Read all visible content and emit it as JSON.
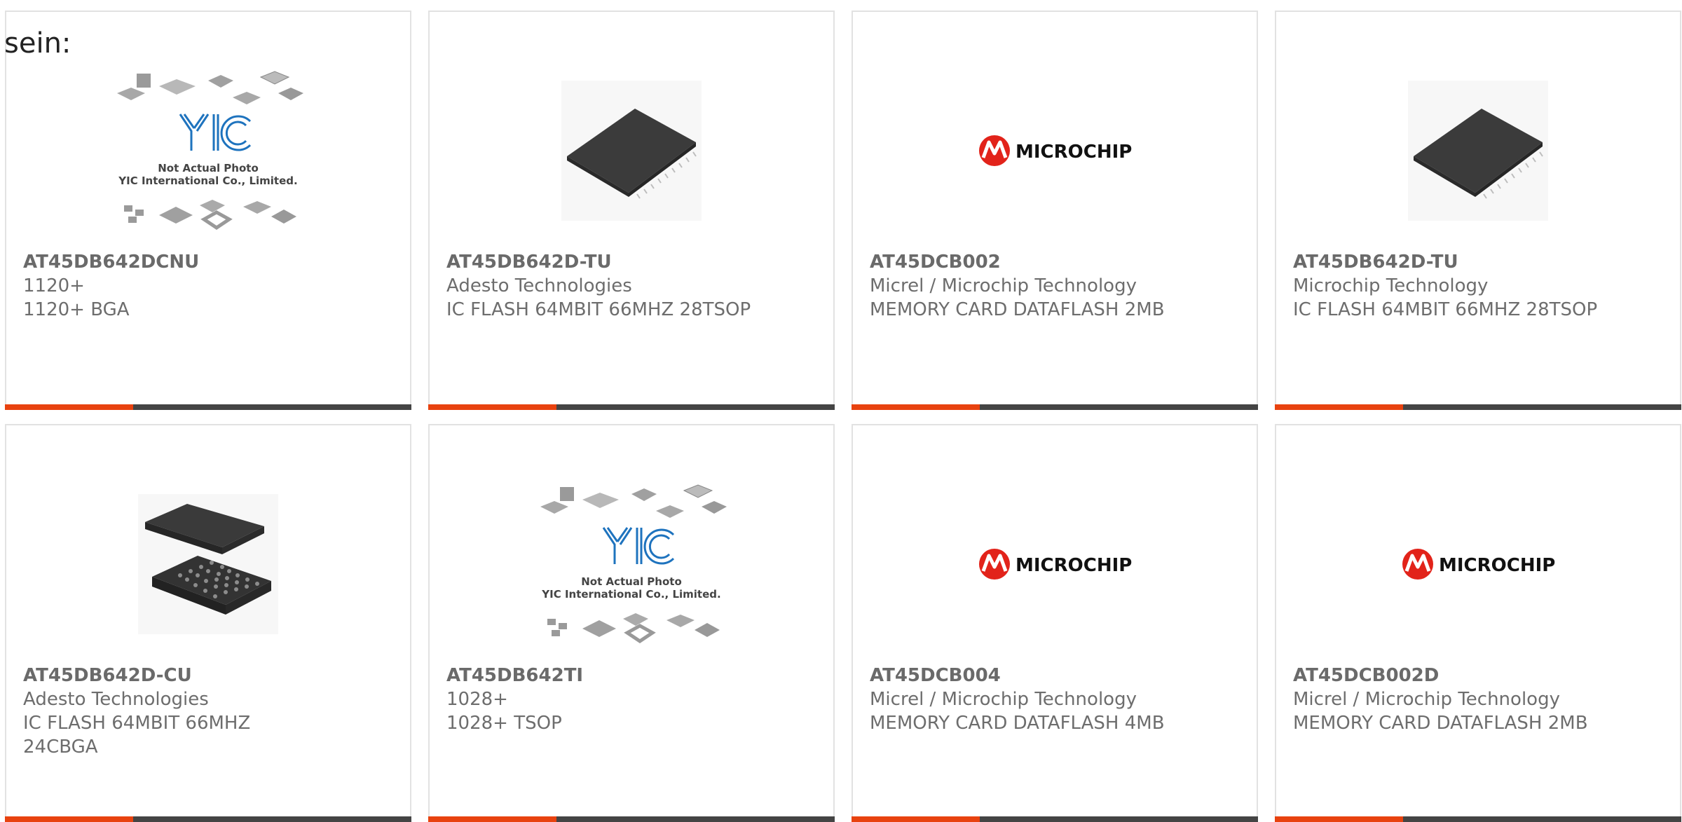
{
  "intro_text": "sein:",
  "colors": {
    "accent": "#e8420f",
    "bar": "#444444",
    "microchip_red": "#e2231a"
  },
  "cards": [
    {
      "part": "AT45DB642DCNU",
      "line1": "1120+",
      "line2": "1120+ BGA",
      "image": "yic-placeholder",
      "yic_caption1": "Not Actual Photo",
      "yic_caption2": "YIC International Co., Limited."
    },
    {
      "part": "AT45DB642D-TU",
      "line1": "Adesto Technologies",
      "line2": "IC FLASH 64MBIT 66MHZ 28TSOP",
      "image": "tsop-chip"
    },
    {
      "part": "AT45DCB002",
      "line1": "Micrel / Microchip Technology",
      "line2": "MEMORY CARD DATAFLASH 2MB",
      "image": "microchip-logo",
      "logo_text": "MICROCHIP"
    },
    {
      "part": "AT45DB642D-TU",
      "line1": "Microchip Technology",
      "line2": "IC FLASH 64MBIT 66MHZ 28TSOP",
      "image": "tsop-chip"
    },
    {
      "part": "AT45DB642D-CU",
      "line1": "Adesto Technologies",
      "line2": "IC FLASH 64MBIT 66MHZ",
      "line3": "24CBGA",
      "image": "bga-chip"
    },
    {
      "part": "AT45DB642TI",
      "line1": "1028+",
      "line2": "1028+ TSOP",
      "image": "yic-placeholder",
      "yic_caption1": "Not Actual Photo",
      "yic_caption2": "YIC International Co., Limited."
    },
    {
      "part": "AT45DCB004",
      "line1": "Micrel / Microchip Technology",
      "line2": "MEMORY CARD DATAFLASH 4MB",
      "image": "microchip-logo",
      "logo_text": "MICROCHIP"
    },
    {
      "part": "AT45DCB002D",
      "line1": "Micrel / Microchip Technology",
      "line2": "MEMORY CARD DATAFLASH 2MB",
      "image": "microchip-logo",
      "logo_text": "MICROCHIP"
    }
  ]
}
